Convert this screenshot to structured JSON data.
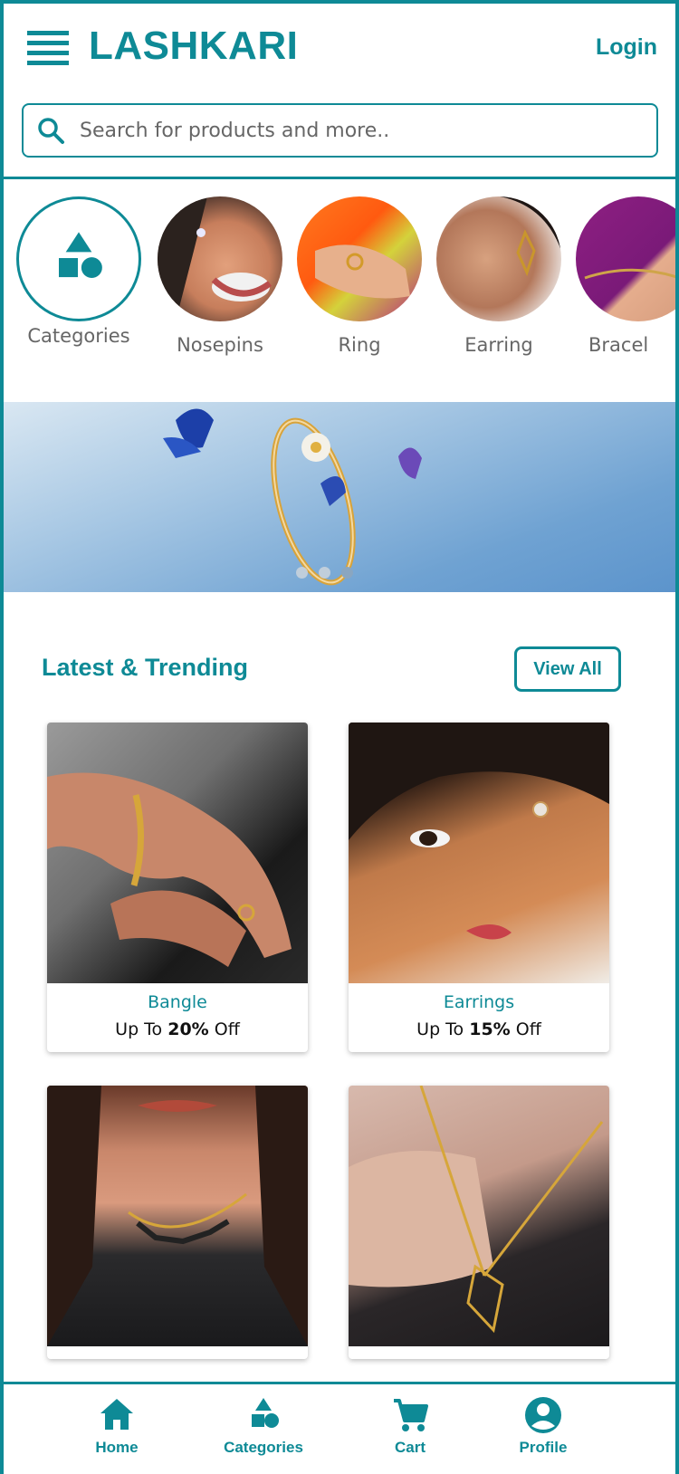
{
  "header": {
    "brand": "LASHKARI",
    "login_label": "Login",
    "search_placeholder": "Search for products and more.."
  },
  "categories": [
    {
      "label": "Categories",
      "icon": "shapes-icon"
    },
    {
      "label": "Nosepins"
    },
    {
      "label": "Ring"
    },
    {
      "label": "Earring"
    },
    {
      "label": "Bracel"
    }
  ],
  "banner": {
    "slide_count": 3,
    "active_index": 2
  },
  "section": {
    "title": "Latest & Trending",
    "view_all_label": "View All"
  },
  "products": [
    {
      "name": "Bangle",
      "prefix": "Up To ",
      "percent": "20%",
      "suffix": " Off"
    },
    {
      "name": "Earrings",
      "prefix": "Up To ",
      "percent": "15%",
      "suffix": " Off"
    },
    {
      "name": "",
      "prefix": "",
      "percent": "",
      "suffix": ""
    },
    {
      "name": "",
      "prefix": "",
      "percent": "",
      "suffix": ""
    }
  ],
  "bottom_nav": [
    {
      "label": "Home",
      "icon": "home-icon"
    },
    {
      "label": "Categories",
      "icon": "shapes-icon"
    },
    {
      "label": "Cart",
      "icon": "cart-icon"
    },
    {
      "label": "Profile",
      "icon": "profile-icon"
    }
  ],
  "colors": {
    "accent": "#0e8a96"
  }
}
